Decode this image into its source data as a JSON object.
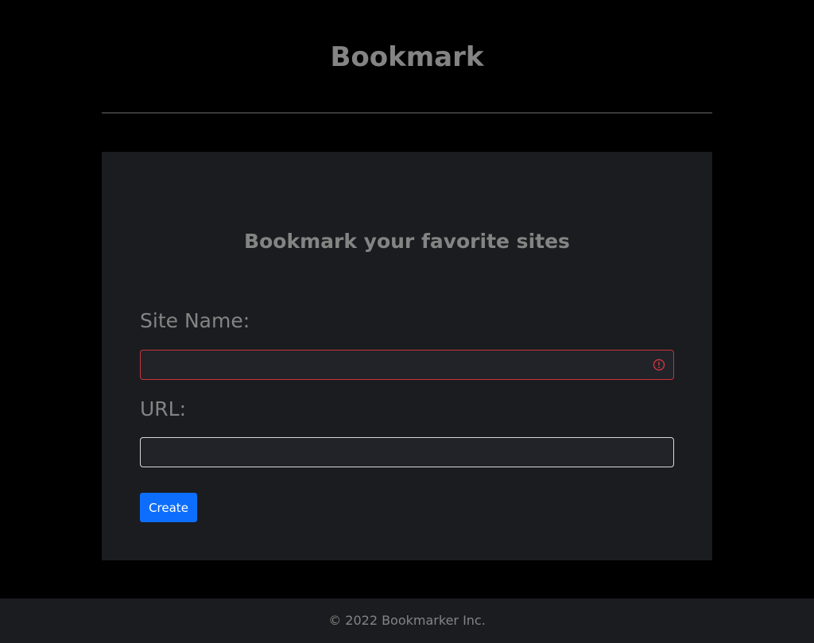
{
  "header": {
    "title": "Bookmark"
  },
  "form": {
    "heading": "Bookmark your favorite sites",
    "site_name": {
      "label": "Site Name:",
      "value": "",
      "state": "invalid"
    },
    "url": {
      "label": "URL:",
      "value": ""
    },
    "submit_label": "Create"
  },
  "footer": {
    "text": "© 2022 Bookmarker Inc."
  },
  "colors": {
    "background": "#000000",
    "card": "#1b1c1f",
    "text_muted": "#848484",
    "input_bg": "#212328",
    "error": "#c7343f",
    "primary": "#0d6efd"
  },
  "icons": {
    "validation": "error-circle-icon"
  }
}
